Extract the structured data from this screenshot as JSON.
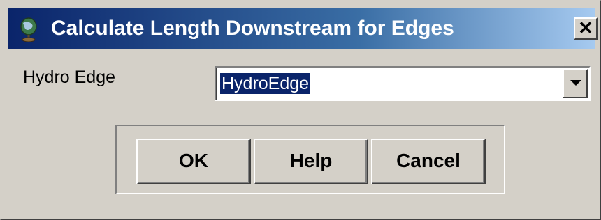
{
  "window": {
    "title": "Calculate Length Downstream for Edges",
    "close_label": "✕",
    "app_icon": "globe-icon"
  },
  "form": {
    "hydro_edge_label": "Hydro Edge",
    "hydro_edge_value": "HydroEdge"
  },
  "buttons": {
    "ok_label": "OK",
    "help_label": "Help",
    "cancel_label": "Cancel"
  },
  "colors": {
    "titlebar_start": "#0a246a",
    "titlebar_end": "#a6caf0",
    "face": "#d4d0c8",
    "selection": "#0a246a"
  }
}
